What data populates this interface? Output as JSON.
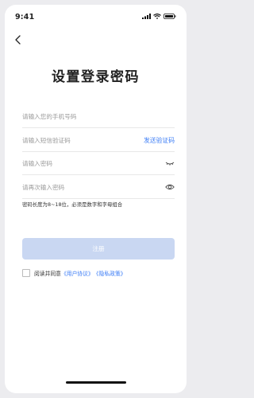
{
  "status": {
    "time": "9:41"
  },
  "page": {
    "title": "设置登录密码"
  },
  "form": {
    "phone_placeholder": "请输入您的手机号码",
    "code_placeholder": "请输入短信验证码",
    "send_code_label": "发送验证码",
    "password_placeholder": "请输入密码",
    "confirm_placeholder": "请再次输入密码",
    "password_hint": "密码长度为8~18位，必须是数字和字母组合",
    "register_label": "注册"
  },
  "agreement": {
    "prefix": "阅读并同意",
    "user_agreement": "《用户协议》",
    "privacy_policy": "《隐私政策》"
  },
  "icons": {
    "back": "chevron-left-icon",
    "password_visibility": "eye-closed-icon",
    "confirm_visibility": "eye-open-icon"
  },
  "colors": {
    "accent": "#3b7cf6",
    "button_disabled": "#c9d7f2"
  }
}
